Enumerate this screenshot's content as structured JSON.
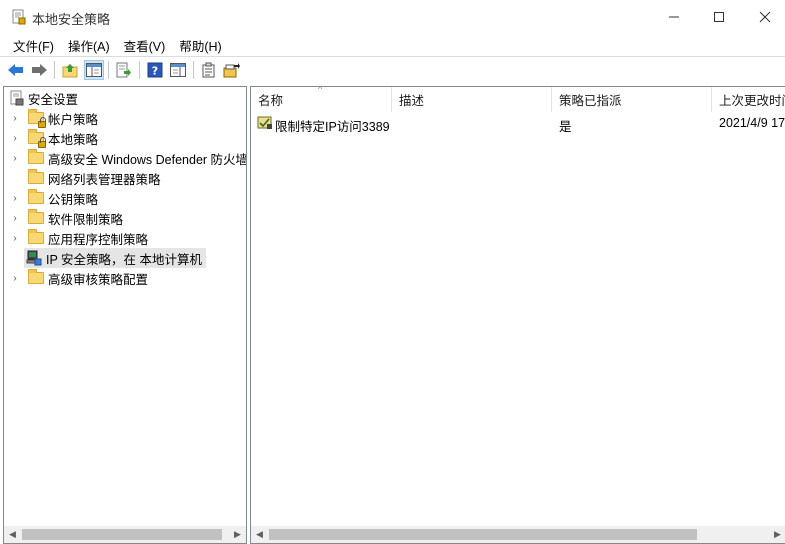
{
  "window": {
    "title": "本地安全策略",
    "min_glyph": "—",
    "max_glyph": "☐",
    "close_glyph": "✕"
  },
  "menu": [
    {
      "label": "文件(F)"
    },
    {
      "label": "操作(A)"
    },
    {
      "label": "查看(V)"
    },
    {
      "label": "帮助(H)"
    }
  ],
  "toolbar": {
    "icons": [
      "back-arrow-icon",
      "forward-arrow-icon",
      "up-folder-icon",
      "show-hide-tree-icon",
      "export-list-icon",
      "help-icon",
      "action-pane-icon",
      "policy-list-icon",
      "assign-policy-icon"
    ]
  },
  "tree": {
    "root_label": "安全设置",
    "items": [
      {
        "label": "帐户策略",
        "expandable": true,
        "icon": "locked-folder-icon"
      },
      {
        "label": "本地策略",
        "expandable": true,
        "icon": "locked-folder-icon"
      },
      {
        "label": "高级安全 Windows Defender 防火墙",
        "expandable": true,
        "icon": "folder-icon"
      },
      {
        "label": "网络列表管理器策略",
        "expandable": false,
        "icon": "folder-icon"
      },
      {
        "label": "公钥策略",
        "expandable": true,
        "icon": "folder-icon"
      },
      {
        "label": "软件限制策略",
        "expandable": true,
        "icon": "folder-icon"
      },
      {
        "label": "应用程序控制策略",
        "expandable": true,
        "icon": "folder-icon"
      },
      {
        "label": "IP 安全策略，在 本地计算机",
        "expandable": false,
        "icon": "ip-security-icon",
        "selected": true
      },
      {
        "label": "高级审核策略配置",
        "expandable": true,
        "icon": "folder-icon"
      }
    ],
    "chevron": "›"
  },
  "list": {
    "columns": [
      "名称",
      "描述",
      "策略已指派",
      "上次更改时间"
    ],
    "sort_glyph": "^",
    "rows": [
      {
        "name": "限制特定IP访问3389",
        "description": "",
        "assigned": "是",
        "modified": "2021/4/9 17"
      }
    ]
  },
  "colors": {
    "selection": "#e5e5e5",
    "accent_blue": "#2b78d4",
    "folder_yellow": "#f8d775"
  }
}
